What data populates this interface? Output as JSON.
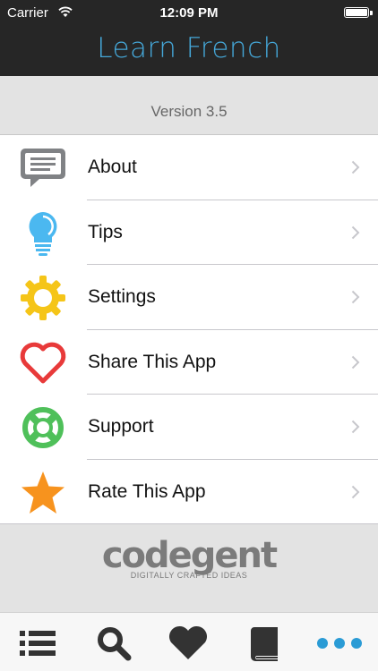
{
  "status": {
    "carrier": "Carrier",
    "time": "12:09 PM"
  },
  "nav": {
    "title": "Learn French"
  },
  "version": "Version 3.5",
  "menu": [
    {
      "label": "About",
      "icon": "speech-bubble-icon",
      "color": "#808285"
    },
    {
      "label": "Tips",
      "icon": "lightbulb-icon",
      "color": "#4bb8f0"
    },
    {
      "label": "Settings",
      "icon": "gear-icon",
      "color": "#f5c518"
    },
    {
      "label": "Share This App",
      "icon": "heart-icon",
      "color": "#e83a3a"
    },
    {
      "label": "Support",
      "icon": "lifebuoy-icon",
      "color": "#4fc05a"
    },
    {
      "label": "Rate This App",
      "icon": "star-icon",
      "color": "#f7931e"
    }
  ],
  "footer": {
    "logo": "codegent",
    "tagline": "DIGITALLY CRAFTED IDEAS"
  },
  "tabs": [
    {
      "icon": "list-icon",
      "color": "#333333"
    },
    {
      "icon": "search-icon",
      "color": "#333333"
    },
    {
      "icon": "heart-icon",
      "color": "#333333"
    },
    {
      "icon": "book-icon",
      "color": "#333333"
    },
    {
      "icon": "more-icon",
      "color": "#2a9bd5"
    }
  ]
}
